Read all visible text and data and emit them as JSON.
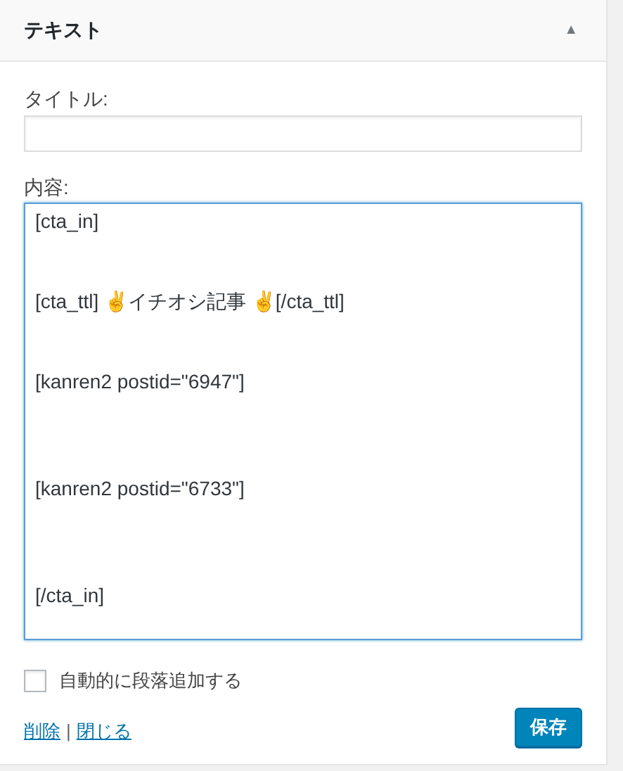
{
  "widget": {
    "title": "テキスト",
    "toggle": "▲",
    "expanded": true
  },
  "title_field": {
    "label": "タイトル:"
  },
  "content_field": {
    "label": "内容:",
    "value": "[cta_in]\n\n\n[cta_ttl] ✌イチオシ記事 ✌[/cta_ttl]\n\n\n[kanren2 postid=\"6947\"]\n\n\n\n[kanren2 postid=\"6733\"]\n\n\n\n[/cta_in]",
    "focused": true
  },
  "auto_paragraph": {
    "label": "自動的に段落追加する",
    "checked": false
  },
  "links": [
    "削除",
    "閉じる"
  ],
  "separator": "|",
  "save_button": "保存"
}
